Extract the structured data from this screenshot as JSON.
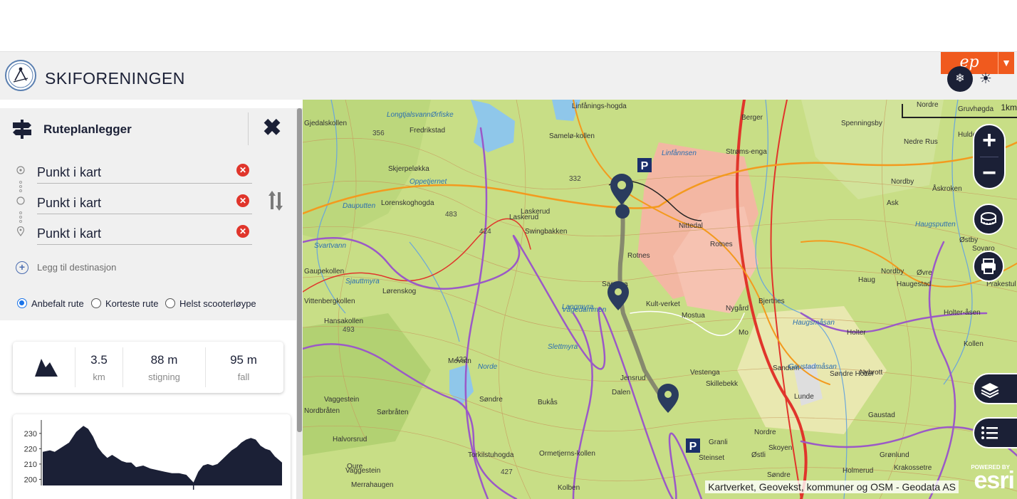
{
  "header": {
    "brand": "SKIFORENINGEN",
    "ep_badge": "ep",
    "colors": {
      "accent": "#1b2036",
      "ep_orange": "#f05a1e"
    }
  },
  "panel": {
    "title": "Ruteplanlegger",
    "stops": [
      {
        "placeholder": "Punkt i kart",
        "icon": "start-circle-icon"
      },
      {
        "placeholder": "Punkt i kart",
        "icon": "waypoint-circle-icon"
      },
      {
        "placeholder": "Punkt i kart",
        "icon": "destination-pin-icon"
      }
    ],
    "add_destination": "Legg til destinasjon",
    "route_options": [
      {
        "label": "Anbefalt rute",
        "selected": true
      },
      {
        "label": "Korteste rute",
        "selected": false
      },
      {
        "label": "Helst scooterløype",
        "selected": false
      }
    ],
    "stats": {
      "distance": {
        "value": "3.5",
        "unit": "km"
      },
      "climb": {
        "value": "88 m",
        "unit": "stigning"
      },
      "descent": {
        "value": "95 m",
        "unit": "fall"
      }
    }
  },
  "chart_data": {
    "type": "area",
    "title": "",
    "xlabel": "",
    "ylabel": "",
    "yticks": [
      200,
      210,
      220,
      230
    ],
    "ylim": [
      196,
      236
    ],
    "x": [
      0,
      3,
      5,
      8,
      11,
      14,
      17,
      19,
      21,
      23,
      25,
      27,
      29,
      31,
      33,
      35,
      37,
      39,
      42,
      45,
      48,
      51,
      54,
      57,
      60,
      63,
      65,
      67,
      69,
      71,
      73,
      75,
      77,
      79,
      81,
      83,
      85,
      87,
      89,
      91,
      93,
      95,
      97,
      100
    ],
    "values": [
      218,
      219,
      218,
      221,
      224,
      231,
      235,
      233,
      228,
      221,
      217,
      214,
      216,
      214,
      212,
      211,
      211,
      208,
      209,
      207,
      206,
      205,
      204,
      204,
      203,
      198,
      205,
      209,
      210,
      209,
      210,
      213,
      216,
      219,
      221,
      224,
      226,
      227,
      226,
      222,
      220,
      219,
      215,
      211
    ]
  },
  "map": {
    "attribution": "Kartverket, Geovekst, kommuner og OSM - Geodata AS",
    "scale_label": "1km",
    "logo_text": "esri",
    "logo_small": "POWERED BY",
    "parking_label": "P",
    "place_labels": [
      "Gjedalskollen",
      "Ørfiske",
      "Fredrikstad",
      "Samelø-kollen",
      "Linfånings-hogda",
      "Berger",
      "Nordre",
      "Gruvhøgda",
      "Spenningsby",
      "Strøms-enga",
      "Skjerpeløkka",
      "Nedre Rus",
      "Hulderbakk",
      "Lorenskoghogda",
      "Laskerud",
      "Nittedal",
      "Nordby",
      "Åskroken",
      "Ask",
      "Swingbakken",
      "Laskerud",
      "Rotnes",
      "Øvre",
      "Østby",
      "Haugsputten",
      "Sovaro",
      "Gaupekollen",
      "Nordby",
      "Haugestad",
      "Rotnes",
      "Vittenbergkollen",
      "Lørenskog",
      "Sagstua",
      "Kult-verket",
      "Nygård",
      "Bjertnes",
      "Haug",
      "Prakestul",
      "Hansakollen",
      "Mostua",
      "Mo",
      "Holter",
      "Holter-åsen",
      "Kollen",
      "Movatn",
      "Vestenga",
      "Skillebekk",
      "Sandum",
      "Søndre Holter",
      "Nybrott",
      "Vaggestein",
      "Nordbråten",
      "Jensrud",
      "Dalen",
      "Lunde",
      "Sørbråten",
      "Bukås",
      "Gaustad",
      "Halvorsrud",
      "Granli",
      "Nordre",
      "Grønlund",
      "Torkilstuhogda",
      "Ormetjerns-kollen",
      "Østli",
      "Skoyen",
      "Krakossetre",
      "Steinset",
      "Holmerud",
      "Vaggestein",
      "Merrahaugen",
      "Kolben",
      "Søndre",
      "Oure",
      "Oppetjernet",
      "Dauputten",
      "Svartvann",
      "Sjauttmyra",
      "Langmyra",
      "Vågedammen",
      "Slettmyra",
      "Norde",
      "Søndre",
      "Gaustadmåsan",
      "Haugsmåsan",
      "Linfånnsen",
      "Longtjalsvann"
    ],
    "spot_heights": [
      "356",
      "332",
      "483",
      "424",
      "493",
      "432",
      "427"
    ]
  }
}
